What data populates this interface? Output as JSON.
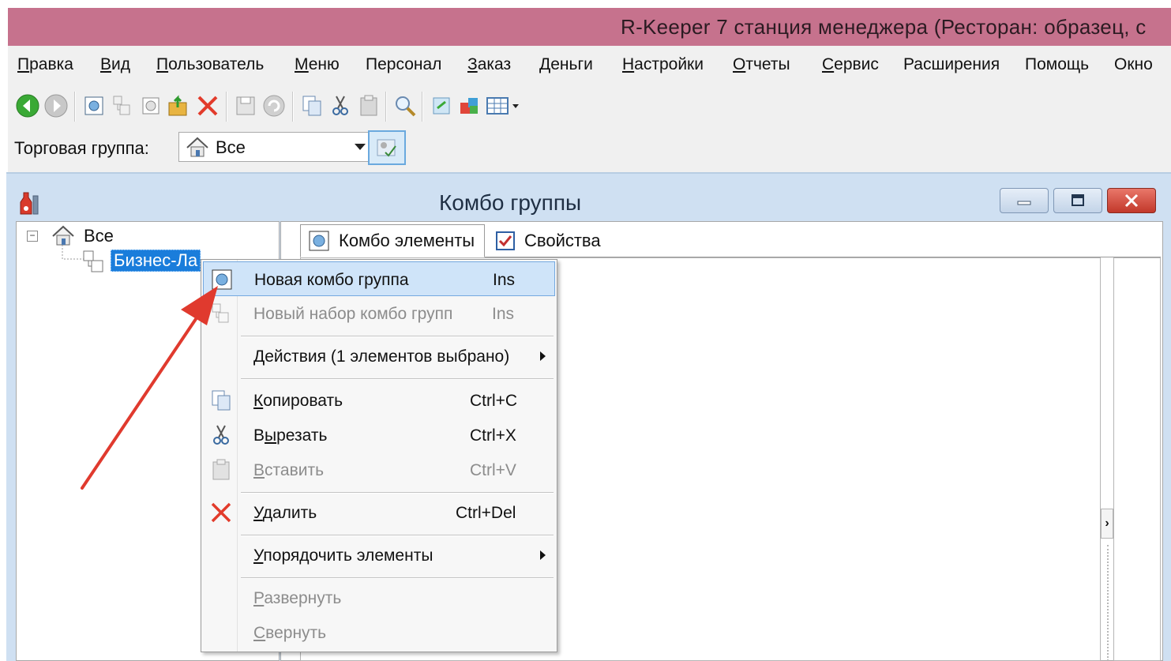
{
  "app": {
    "title": "R-Keeper 7 станция менеджера (Ресторан: образец, с",
    "titlebar_color": "#c6728d"
  },
  "menubar": {
    "items": [
      {
        "label": "Правка",
        "ul": "П",
        "rest": "равка"
      },
      {
        "label": "Вид",
        "ul": "В",
        "rest": "ид"
      },
      {
        "label": "Пользователь",
        "ul": "П",
        "rest": "ользователь"
      },
      {
        "label": "Меню",
        "ul": "М",
        "rest": "еню"
      },
      {
        "label": "Персонал",
        "ul": "",
        "rest": "Персонал"
      },
      {
        "label": "Заказ",
        "ul": "З",
        "rest": "аказ"
      },
      {
        "label": "Деньги",
        "ul": "Д",
        "rest": "еньги"
      },
      {
        "label": "Настройки",
        "ul": "Н",
        "rest": "астройки"
      },
      {
        "label": "Отчеты",
        "ul": "О",
        "rest": "тчеты"
      },
      {
        "label": "Сервис",
        "ul": "С",
        "rest": "ервис"
      },
      {
        "label": "Расширения",
        "ul": "",
        "rest": "Расширения"
      },
      {
        "label": "Помощь",
        "ul": "",
        "rest": "Помощь"
      },
      {
        "label": "Окно",
        "ul": "",
        "rest": "Окно"
      }
    ]
  },
  "toolbar": {
    "buttons": [
      "back-icon",
      "forward-icon",
      "new-combo-group-icon",
      "new-combo-set-icon",
      "new-element-icon",
      "edit-icon",
      "delete-icon",
      "save-icon",
      "undo-icon",
      "copy-icon",
      "cut-icon",
      "paste-icon",
      "search-icon",
      "refresh-icon",
      "puzzle-icon",
      "grid-view-icon"
    ]
  },
  "trade_group": {
    "label": "Торговая группа:",
    "selected": "Все"
  },
  "child_window": {
    "title": "Комбо группы"
  },
  "tree": {
    "root": "Все",
    "child": "Бизнес-Ла"
  },
  "tabs": {
    "combo_elements": "Комбо элементы",
    "properties": "Свойства"
  },
  "context_menu": {
    "new_combo_group": "Новая комбо группа",
    "new_combo_group_key": "Ins",
    "new_combo_set": "Новый набор комбо групп",
    "new_combo_set_key": "Ins",
    "actions": "Действия (1 элементов выбрано)",
    "copy_ul": "К",
    "copy_rest": "опировать",
    "copy_key": "Ctrl+C",
    "cut_pre": "В",
    "cut_ul": "ы",
    "cut_rest": "резать",
    "cut_key": "Ctrl+X",
    "paste_ul": "В",
    "paste_rest": "ставить",
    "paste_key": "Ctrl+V",
    "delete_ul": "У",
    "delete_rest": "далить",
    "delete_key": "Ctrl+Del",
    "sort_ul": "У",
    "sort_rest": "порядочить элементы",
    "expand_ul": "Р",
    "expand_rest": "азвернуть",
    "collapse_ul": "С",
    "collapse_rest": "вернуть"
  },
  "annotation": {
    "arrow_color": "#e03a2e"
  }
}
